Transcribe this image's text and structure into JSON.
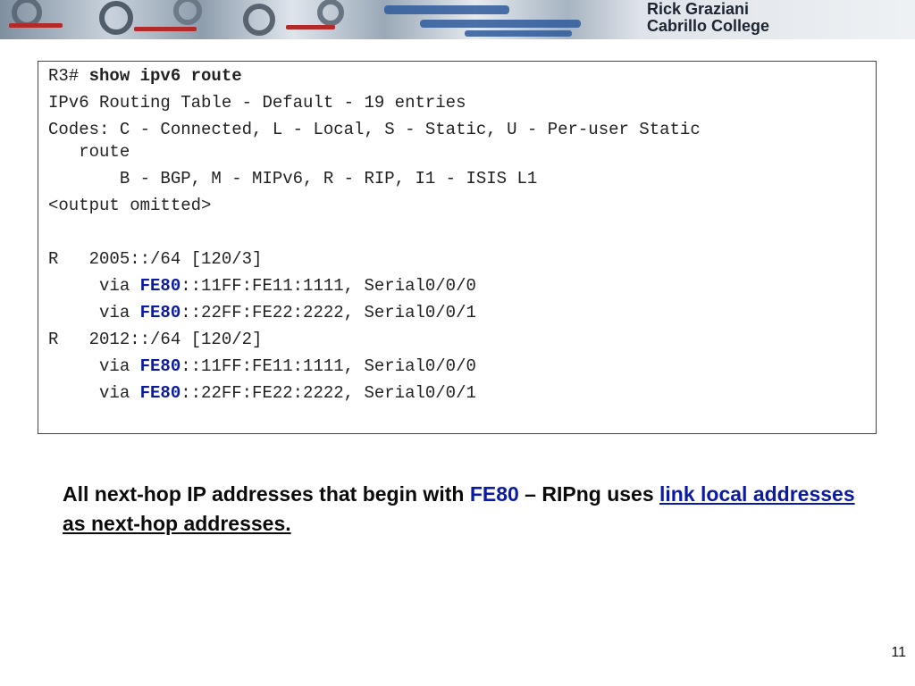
{
  "banner": {
    "line1": "Rick Graziani",
    "line2": "Cabrillo College"
  },
  "terminal": {
    "prompt": "R3# ",
    "command": "show ipv6 route",
    "lines": [
      "IPv6 Routing Table - Default - 19 entries",
      "Codes: C - Connected, L - Local, S - Static, U - Per-user Static",
      "   route",
      "       B - BGP, M - MIPv6, R - RIP, I1 - ISIS L1",
      "<output omitted>",
      "R   2005::/64 [120/3]",
      "R   2012::/64 [120/2]"
    ],
    "via_prefix": "     via ",
    "fe80": "FE80",
    "hop1_rest": "::11FF:FE11:1111, Serial0/0/0",
    "hop2_rest": "::22FF:FE22:2222, Serial0/0/1"
  },
  "caption": {
    "part1": "All next-hop IP addresses that begin with ",
    "fe80": "FE80",
    "part2": " – RIPng uses ",
    "link_text": "link local addresses ",
    "part3": "as next-hop addresses."
  },
  "page_number": "11",
  "colors": {
    "accent_blue": "#0a1aa5",
    "text": "#222222",
    "border": "#444444"
  }
}
